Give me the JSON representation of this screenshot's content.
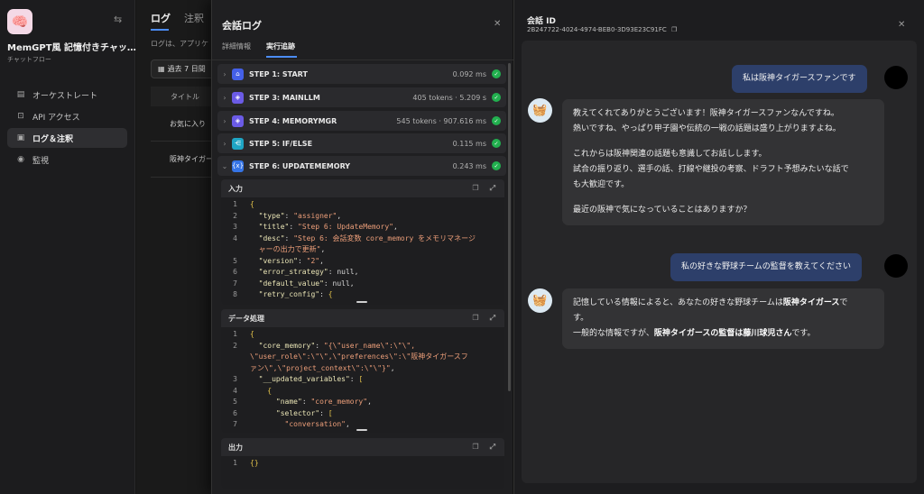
{
  "sidebar": {
    "app_name": "MemGPT風 記憶付きチャッ…",
    "app_type": "チャットフロー",
    "items": [
      {
        "label": "オーケストレート",
        "icon": "orchestrate-icon"
      },
      {
        "label": "API アクセス",
        "icon": "terminal-icon"
      },
      {
        "label": "ログ＆注釈",
        "icon": "document-icon"
      },
      {
        "label": "監視",
        "icon": "monitor-icon"
      }
    ]
  },
  "logs": {
    "tabs": [
      "ログ",
      "注釈"
    ],
    "description": "ログは、アプリケ",
    "date_filter": "過去 7 日間",
    "column_title": "タイトル",
    "rows": [
      "お気に入り",
      "阪神タイガー"
    ]
  },
  "trace": {
    "title": "会話ログ",
    "tabs": [
      "詳細情報",
      "実行追跡"
    ],
    "steps": [
      {
        "name": "STEP 1: START",
        "meta": "0.092 ms",
        "icon": "home-icon"
      },
      {
        "name": "STEP 3: MAINLLM",
        "meta": "405 tokens · 5.209 s",
        "icon": "llm-icon"
      },
      {
        "name": "STEP 4: MEMORYMGR",
        "meta": "545 tokens · 907.616 ms",
        "icon": "llm-icon"
      },
      {
        "name": "STEP 5: IF/ELSE",
        "meta": "0.115 ms",
        "icon": "branch-icon"
      },
      {
        "name": "STEP 6: UPDATEMEMORY",
        "meta": "0.243 ms",
        "icon": "variable-icon"
      }
    ],
    "panels": {
      "input_title": "入力",
      "process_title": "データ処理",
      "output_title": "出力",
      "output_text": "{}"
    }
  },
  "conversation": {
    "title": "会話 ID",
    "id": "2B247722-4024-4974-BEB0-3D93E23C91FC",
    "messages": [
      {
        "role": "user",
        "text": "私は阪神タイガースファンです"
      },
      {
        "role": "bot",
        "paragraphs": [
          [
            "教えてくれてありがとうございます！阪神タイガースファンなんですね。",
            "熱いですね、やっぱり甲子園や伝統の一戦の話題は盛り上がりますよね。"
          ],
          [
            "これからは阪神関連の話題も意識してお話しします。",
            "試合の振り返り、選手の話、打線や継投の考察、ドラフト予想みたいな話で",
            "も大歓迎です。"
          ],
          [
            "最近の阪神で気になっていることはありますか？"
          ]
        ]
      },
      {
        "role": "user",
        "text": "私の好きな野球チームの監督を教えてください"
      },
      {
        "role": "bot",
        "segments": [
          {
            "text": "記憶している情報によると、あなたの好きな野球チームは",
            "bold": false
          },
          {
            "text": "阪神タイガース",
            "bold": true
          },
          {
            "text": "で",
            "bold": false
          },
          {
            "text": "す。",
            "bold": false
          },
          {
            "text": "一般的な情報ですが、",
            "bold": false
          },
          {
            "text": "阪神タイガースの監督は藤川球児さん",
            "bold": true
          },
          {
            "text": "です。",
            "bold": false
          }
        ]
      }
    ]
  },
  "colors": {
    "accent": "#4b8cf5",
    "success": "#22b04f",
    "user_bubble": "#2d3f6a"
  }
}
